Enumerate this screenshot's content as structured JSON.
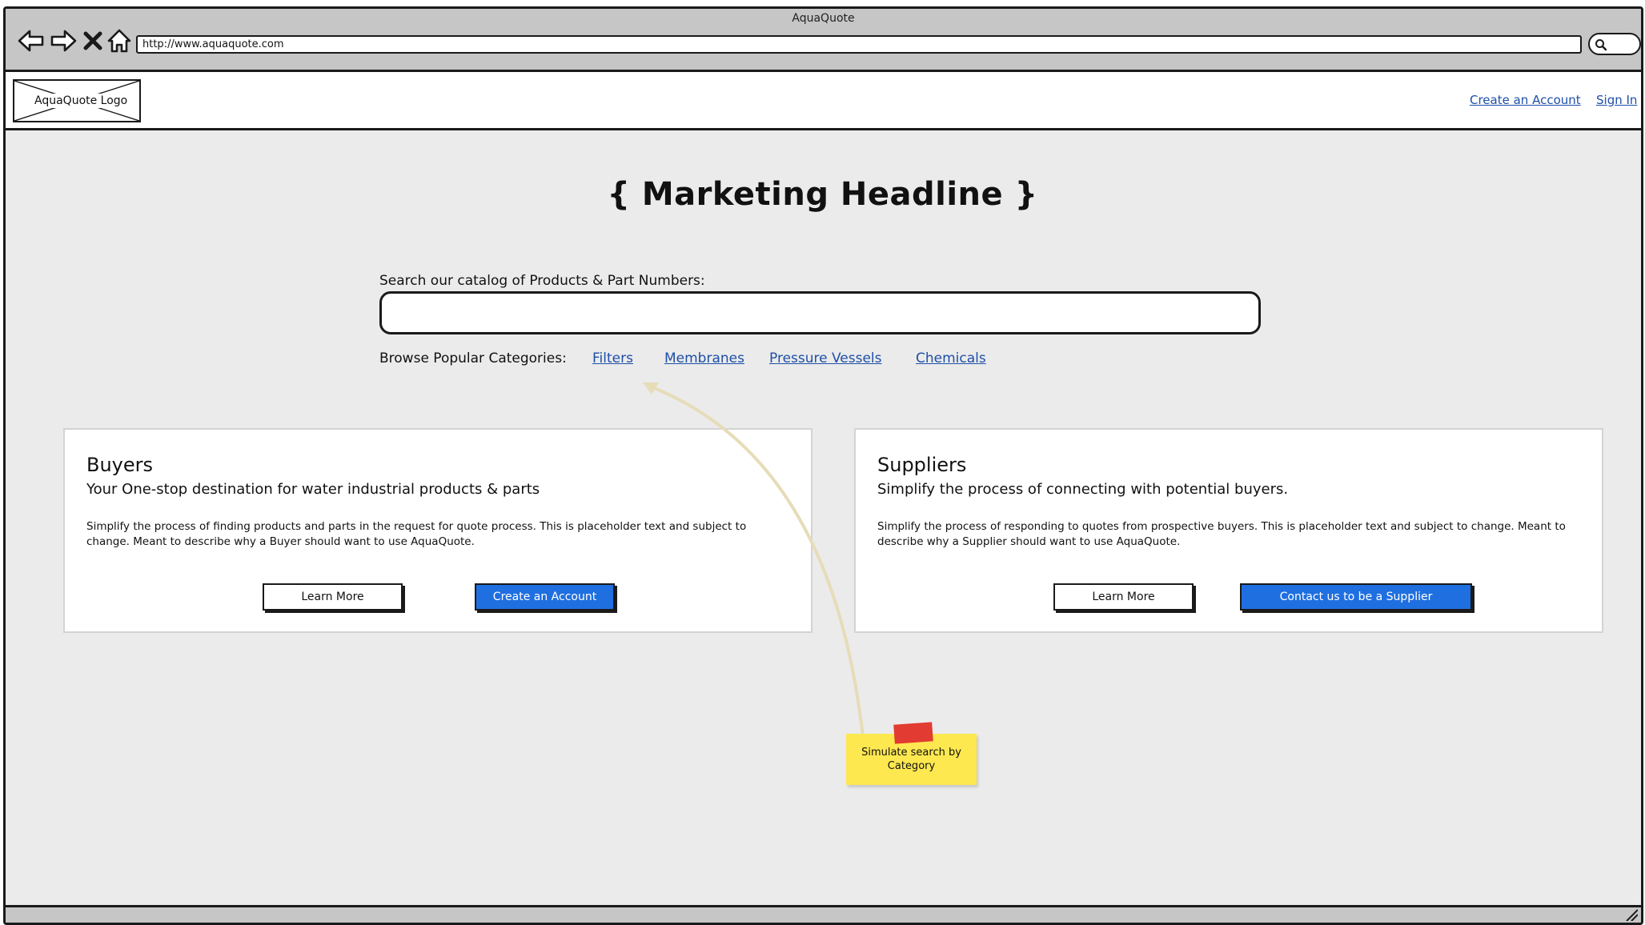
{
  "browser": {
    "window_title": "AquaQuote",
    "url": "http://www.aquaquote.com"
  },
  "header": {
    "logo_label": "AquaQuote Logo",
    "create_account_label": "Create an Account",
    "sign_in_label": "Sign In"
  },
  "hero": {
    "headline": "{ Marketing Headline }",
    "search_label": "Search our catalog of Products & Part Numbers:",
    "search_value": "",
    "browse_label": "Browse Popular Categories:",
    "categories": [
      "Filters",
      "Membranes",
      "Pressure Vessels",
      "Chemicals"
    ]
  },
  "buyers": {
    "title": "Buyers",
    "subtitle": "Your One-stop destination for water industrial products & parts",
    "description": "Simplify the process of finding products and parts in the request for quote process. This is placeholder text and subject to change. Meant to describe why a Buyer should want to use AquaQuote.",
    "learn_more_label": "Learn More",
    "primary_label": "Create an Account"
  },
  "suppliers": {
    "title": "Suppliers",
    "subtitle": "Simplify the process of connecting with potential buyers.",
    "description": "Simplify the process of responding to quotes from prospective buyers. This is placeholder text and subject to change. Meant to describe why a Supplier should want to use AquaQuote.",
    "learn_more_label": "Learn More",
    "primary_label": "Contact us to be a Supplier"
  },
  "annotation": {
    "note_text": "Simulate search by Category"
  },
  "icons": [
    "back-arrow-icon",
    "forward-arrow-icon",
    "close-icon",
    "home-icon",
    "search-icon",
    "resize-grip-icon"
  ],
  "colors": {
    "link": "#1e4fa8",
    "primary_button": "#1f6fe0",
    "page_background": "#ebebeb",
    "chrome": "#c6c6c6",
    "sticky_note": "#fde84f",
    "sticky_tape": "#e23b32"
  }
}
